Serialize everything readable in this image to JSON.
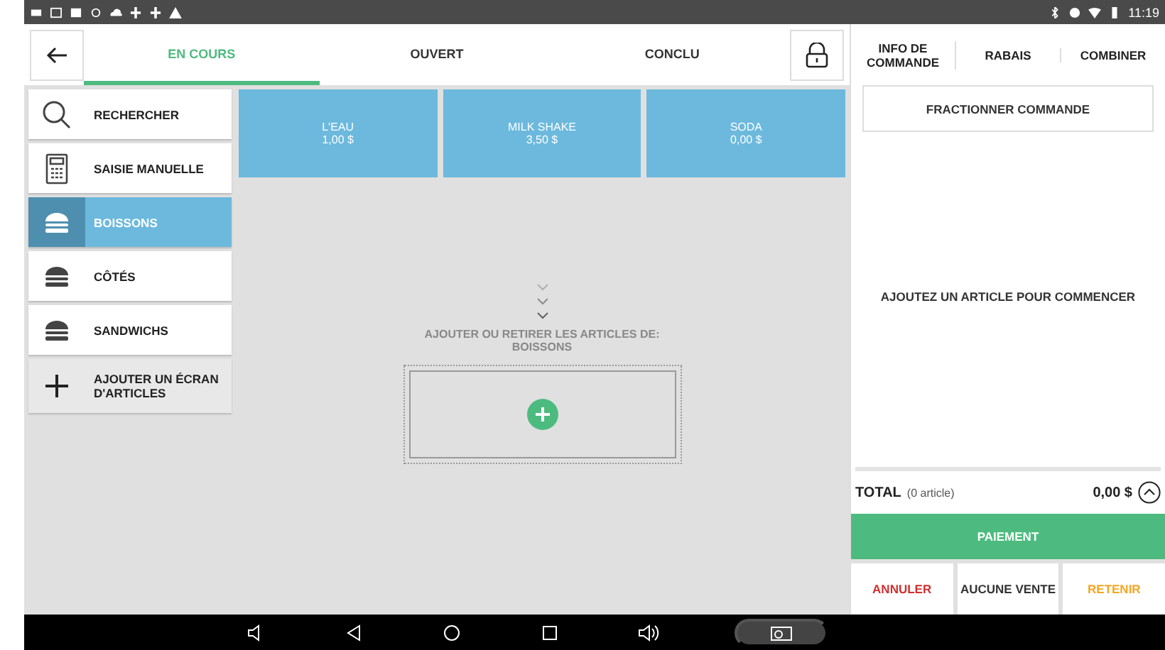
{
  "status_bar": {
    "time": "11:19"
  },
  "tabs": [
    {
      "label": "EN COURS",
      "selected": true
    },
    {
      "label": "OUVERT",
      "selected": false
    },
    {
      "label": "CONCLU",
      "selected": false
    }
  ],
  "categories": [
    {
      "kind": "search",
      "label": "RECHERCHER",
      "selected": false
    },
    {
      "kind": "calculator",
      "label": "SAISIE MANUELLE",
      "selected": false
    },
    {
      "kind": "burger",
      "label": "BOISSONS",
      "selected": true
    },
    {
      "kind": "burger",
      "label": "CÔTÉS",
      "selected": false
    },
    {
      "kind": "burger",
      "label": "SANDWICHS",
      "selected": false
    },
    {
      "kind": "add",
      "label": "AJOUTER UN ÉCRAN D'ARTICLES",
      "selected": false
    }
  ],
  "products": [
    {
      "name": "L'EAU",
      "price": "1,00 $"
    },
    {
      "name": "MILK SHAKE",
      "price": "3,50 $"
    },
    {
      "name": "SODA",
      "price": "0,00 $"
    }
  ],
  "edit_hint": "AJOUTER OU RETIRER LES ARTICLES DE: BOISSONS",
  "order_panel": {
    "tabs": [
      "INFO DE COMMANDE",
      "RABAIS",
      "COMBINER"
    ],
    "split_button": "FRACTIONNER COMMANDE",
    "empty_message": "AJOUTEZ UN ARTICLE POUR COMMENCER",
    "total_label": "TOTAL",
    "item_count": "(0 article)",
    "total": "0,00 $",
    "pay_button": "PAIEMENT",
    "actions": [
      {
        "kind": "cancel",
        "label": "ANNULER"
      },
      {
        "kind": "no_sale",
        "label": "AUCUNE VENTE"
      },
      {
        "kind": "hold",
        "label": "RETENIR"
      }
    ]
  }
}
